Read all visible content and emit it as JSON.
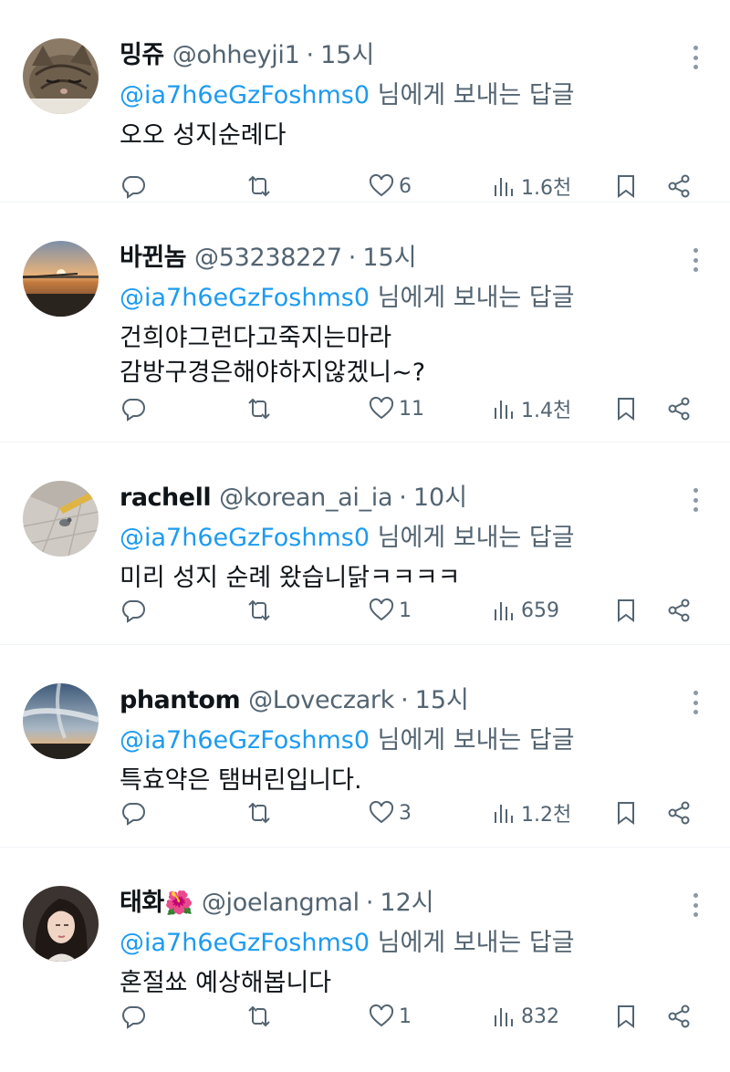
{
  "tweets": [
    {
      "name": "밍쥬",
      "emoji": "",
      "handle": "@ohheyji1",
      "time": "15시",
      "reply_mention": "@ia7h6eGzFoshms0",
      "reply_suffix": " 님에게 보내는 답글",
      "lines": [
        "오오 성지순례다"
      ],
      "likes": "6",
      "views": "1.6천",
      "avatar": "cat-photo"
    },
    {
      "name": "바뀐놈",
      "emoji": "",
      "handle": "@53238227",
      "time": "15시",
      "reply_mention": "@ia7h6eGzFoshms0",
      "reply_suffix": " 님에게 보내는 답글",
      "lines": [
        "건희야그런다고죽지는마라",
        "감방구경은해야하지않겠니~?"
      ],
      "likes": "11",
      "views": "1.4천",
      "avatar": "sunset-pier-photo"
    },
    {
      "name": "rachell",
      "emoji": "",
      "handle": "@korean_ai_ia",
      "time": "10시",
      "reply_mention": "@ia7h6eGzFoshms0",
      "reply_suffix": " 님에게 보내는 답글",
      "lines": [
        "미리 성지 순례 왔습니닭ㅋㅋㅋㅋ"
      ],
      "likes": "1",
      "views": "659",
      "avatar": "pigeon-pavement-photo"
    },
    {
      "name": "phantom",
      "emoji": "",
      "handle": "@Loveczark",
      "time": "15시",
      "reply_mention": "@ia7h6eGzFoshms0",
      "reply_suffix": " 님에게 보내는 답글",
      "lines": [
        "특효약은 탬버린입니다."
      ],
      "likes": "3",
      "views": "1.2천",
      "avatar": "sky-clouds-photo"
    },
    {
      "name": "태화",
      "emoji": "🌺",
      "handle": "@joelangmal",
      "time": "12시",
      "reply_mention": "@ia7h6eGzFoshms0",
      "reply_suffix": " 님에게 보내는 답글",
      "lines": [
        "혼절쑈 예상해봅니다"
      ],
      "likes": "1",
      "views": "832",
      "avatar": "portrait-photo"
    }
  ],
  "separator": "·",
  "colors": {
    "text": "#0f1419",
    "secondary": "#536471",
    "link": "#1d9bf0",
    "divider": "#eff3f4"
  },
  "icons": [
    "reply-icon",
    "retweet-icon",
    "like-icon",
    "views-icon",
    "bookmark-icon",
    "share-icon",
    "more-icon"
  ]
}
